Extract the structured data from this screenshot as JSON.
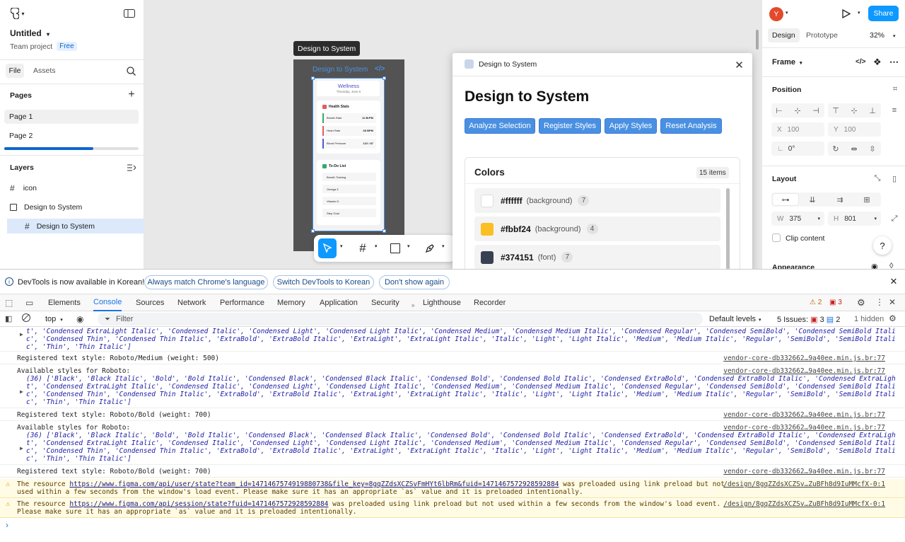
{
  "left": {
    "file_name": "Untitled",
    "team": "Team project",
    "plan_badge": "Free",
    "tabs": [
      "File",
      "Assets"
    ],
    "pages_heading": "Pages",
    "pages": [
      "Page 1",
      "Page 2"
    ],
    "layers_heading": "Layers",
    "layers": [
      "icon",
      "Design to System",
      "Design to System"
    ]
  },
  "canvas": {
    "tooltip": "Design to System",
    "frame_label": "Design to System",
    "phone": {
      "title": "Wellness",
      "date": "Thursday, June 5",
      "stats_heading": "Health Stats",
      "stats": [
        {
          "label": "Breath Rate",
          "value": "12 BrPM"
        },
        {
          "label": "Heart Rate",
          "value": "68 BPM"
        },
        {
          "label": "Blood Pressure",
          "value": "122 / 87"
        }
      ],
      "todo_heading": "To-Do List",
      "todos": [
        "Breath Training",
        "Omega 3",
        "Vitamin D",
        "Step Goal"
      ]
    }
  },
  "plugin": {
    "window_title": "Design to System",
    "heading": "Design to System",
    "buttons": [
      "Analyze Selection",
      "Register Styles",
      "Apply Styles",
      "Reset Analysis"
    ],
    "colors_heading": "Colors",
    "items_count": "15 items",
    "colors": [
      {
        "hex": "#ffffff",
        "type": "(background)",
        "count": "7",
        "swatch": "#ffffff"
      },
      {
        "hex": "#fbbf24",
        "type": "(background)",
        "count": "4",
        "swatch": "#fbbf24"
      },
      {
        "hex": "#374151",
        "type": "(font)",
        "count": "7",
        "swatch": "#374151"
      }
    ]
  },
  "right": {
    "avatar": "Y",
    "share": "Share",
    "tabs": [
      "Design",
      "Prototype"
    ],
    "zoom": "32%",
    "frame_label": "Frame",
    "position_heading": "Position",
    "x_label": "X",
    "x_value": "100",
    "y_label": "Y",
    "y_value": "100",
    "rotation": "0°",
    "layout_heading": "Layout",
    "w_label": "W",
    "w_value": "375",
    "h_label": "H",
    "h_value": "801",
    "clip_content": "Clip content",
    "appearance": "Appearance",
    "help": "?"
  },
  "devtools": {
    "info_text": "DevTools is now available in Korean!",
    "info_buttons": [
      "Always match Chrome's language",
      "Switch DevTools to Korean",
      "Don't show again"
    ],
    "tabs": [
      "Elements",
      "Console",
      "Sources",
      "Network",
      "Performance",
      "Memory",
      "Application",
      "Security",
      "Lighthouse",
      "Recorder"
    ],
    "warn_count": "2",
    "err_count": "3",
    "context": "top",
    "filter_placeholder": "Filter",
    "levels": "Default levels",
    "issues_label": "5 Issues:",
    "issues_warn": "3",
    "issues_info": "2",
    "hidden": "1 hidden",
    "src": "vendor-core-db332662…9a40ee.min.js.br:77",
    "src2": "/design/8gqZZdsXCZSv…ZuBFh8d9IuMMcfX-0:1",
    "logs": {
      "a1": "t', 'Condensed ExtraLight Italic', 'Condensed Italic', 'Condensed Light', 'Condensed Light Italic', 'Condensed Medium', 'Condensed Medium Italic', 'Condensed Regular', 'Condensed SemiBold', 'Condensed SemiBold Itali",
      "a2": "c', 'Condensed Thin', 'Condensed Thin Italic', 'ExtraBold', 'ExtraBold Italic', 'ExtraLight', 'ExtraLight Italic', 'Italic', 'Light', 'Light Italic', 'Medium', 'Medium Italic', 'Regular', 'SemiBold', 'SemiBold Itali",
      "a3": "c', 'Thin', 'Thin Italic']",
      "b": "Registered text style: Roboto/Medium (weight: 500)",
      "c0": "Available styles for Roboto:",
      "c1": "(36) ['Black', 'Black Italic', 'Bold', 'Bold Italic', 'Condensed Black', 'Condensed Black Italic', 'Condensed Bold', 'Condensed Bold Italic', 'Condensed ExtraBold', 'Condensed ExtraBold Italic', 'Condensed ExtraLigh",
      "c2": "t', 'Condensed ExtraLight Italic', 'Condensed Italic', 'Condensed Light', 'Condensed Light Italic', 'Condensed Medium', 'Condensed Medium Italic', 'Condensed Regular', 'Condensed SemiBold', 'Condensed SemiBold Itali",
      "c3": "c', 'Condensed Thin', 'Condensed Thin Italic', 'ExtraBold', 'ExtraBold Italic', 'ExtraLight', 'ExtraLight Italic', 'Italic', 'Light', 'Light Italic', 'Medium', 'Medium Italic', 'Regular', 'SemiBold', 'SemiBold Itali",
      "c4": "c', 'Thin', 'Thin Italic']",
      "d": "Registered text style: Roboto/Bold (weight: 700)",
      "f": "Registered text style: Roboto/Bold (weight: 700)",
      "w1a": "The resource ",
      "w1url": "https://www.figma.com/api/user/state?team_id=1471467574919880738&file_key=8gqZZdsXCZSvFmHYt6lbRm&fuid=1471467572928592884",
      "w1b": " was preloaded using link preload but not",
      "w1c": "used within a few seconds from the window's load event. Please make sure it has an appropriate `as` value and it is preloaded intentionally.",
      "w2a": "The resource ",
      "w2url": "https://www.figma.com/api/session/state?fuid=1471467572928592884",
      "w2b": " was preloaded using link preload but not used within a few seconds from the window's load event.",
      "w2c": "Please make sure it has an appropriate `as` value and it is preloaded intentionally."
    }
  }
}
